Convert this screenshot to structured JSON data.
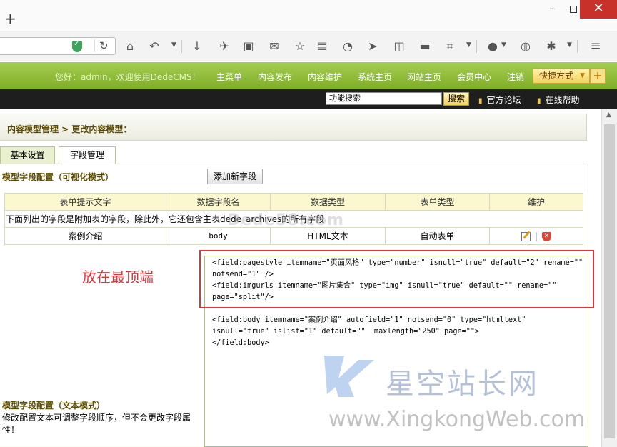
{
  "browser": {
    "new_tab": "+",
    "window_controls": {
      "minimize": "–",
      "close": "✕"
    },
    "toolbar_icons": [
      "shield-icon",
      "reload-icon",
      "home-icon",
      "back-icon",
      "download-icon",
      "bird-icon",
      "reader-icon",
      "mail-icon",
      "bookmark-star-icon",
      "clipboard-icon",
      "rss-icon",
      "send-icon",
      "sidebar-icon",
      "folder-icon",
      "crop-icon",
      "adblock-icon",
      "globe-icon",
      "bug-icon",
      "menu-icon"
    ]
  },
  "cms_header": {
    "welcome": "您好：admin，欢迎使用DedeCMS！",
    "nav": [
      "主菜单",
      "内容发布",
      "内容维护",
      "系统主页",
      "网站主页",
      "会员中心",
      "注销"
    ],
    "quick_menu": "快捷方式",
    "quick_add": "+",
    "search_value": "功能搜索",
    "search_button": "搜索",
    "links": [
      "官方论坛",
      "在线帮助"
    ]
  },
  "breadcrumb": "内容模型管理 > 更改内容模型：",
  "tabs": [
    "基本设置",
    "字段管理"
  ],
  "visual_mode": {
    "title": "模型字段配置（可视化模式）",
    "add_button": "添加新字段"
  },
  "field_table": {
    "headers": [
      "表单提示文字",
      "数据字段名",
      "数据类型",
      "表单类型",
      "维护"
    ],
    "note": "下面列出的字段是附加表的字段，除此外，它还包含主表dede_archives的所有字段",
    "rows": [
      {
        "label": "案例介绍",
        "field": "body",
        "data_type": "HTML文本",
        "form_type": "自动表单",
        "separator": "|"
      }
    ]
  },
  "text_mode": {
    "title": "模型字段配置（文本模式）",
    "description": "修改配置文本可调整字段顺序，但不会更改字段属性！"
  },
  "editor": {
    "block1": "<field:pagestyle itemname=\"页面风格\" type=\"number\" isnull=\"true\" default=\"2\" rename=\"\" notsend=\"1\" />\n<field:imgurls itemname=\"图片集合\" type=\"img\" isnull=\"true\" default=\"\" rename=\"\" page=\"split\"/>",
    "block2": "<field:body itemname=\"案例介绍\" autofield=\"1\" notsend=\"0\" type=\"htmltext\" isnull=\"true\" islist=\"1\" default=\"\"  maxlength=\"250\" page=\"\">\n</field:body>"
  },
  "annotation": "放在最顶端",
  "watermarks": {
    "site": "Dede58.com",
    "cn": "星空站长网",
    "en": "www.XingkongWeb.com"
  },
  "colors": {
    "header_green": "#8fbd35",
    "highlight_red": "#d8363a",
    "table_header": "#fbf7cf"
  }
}
